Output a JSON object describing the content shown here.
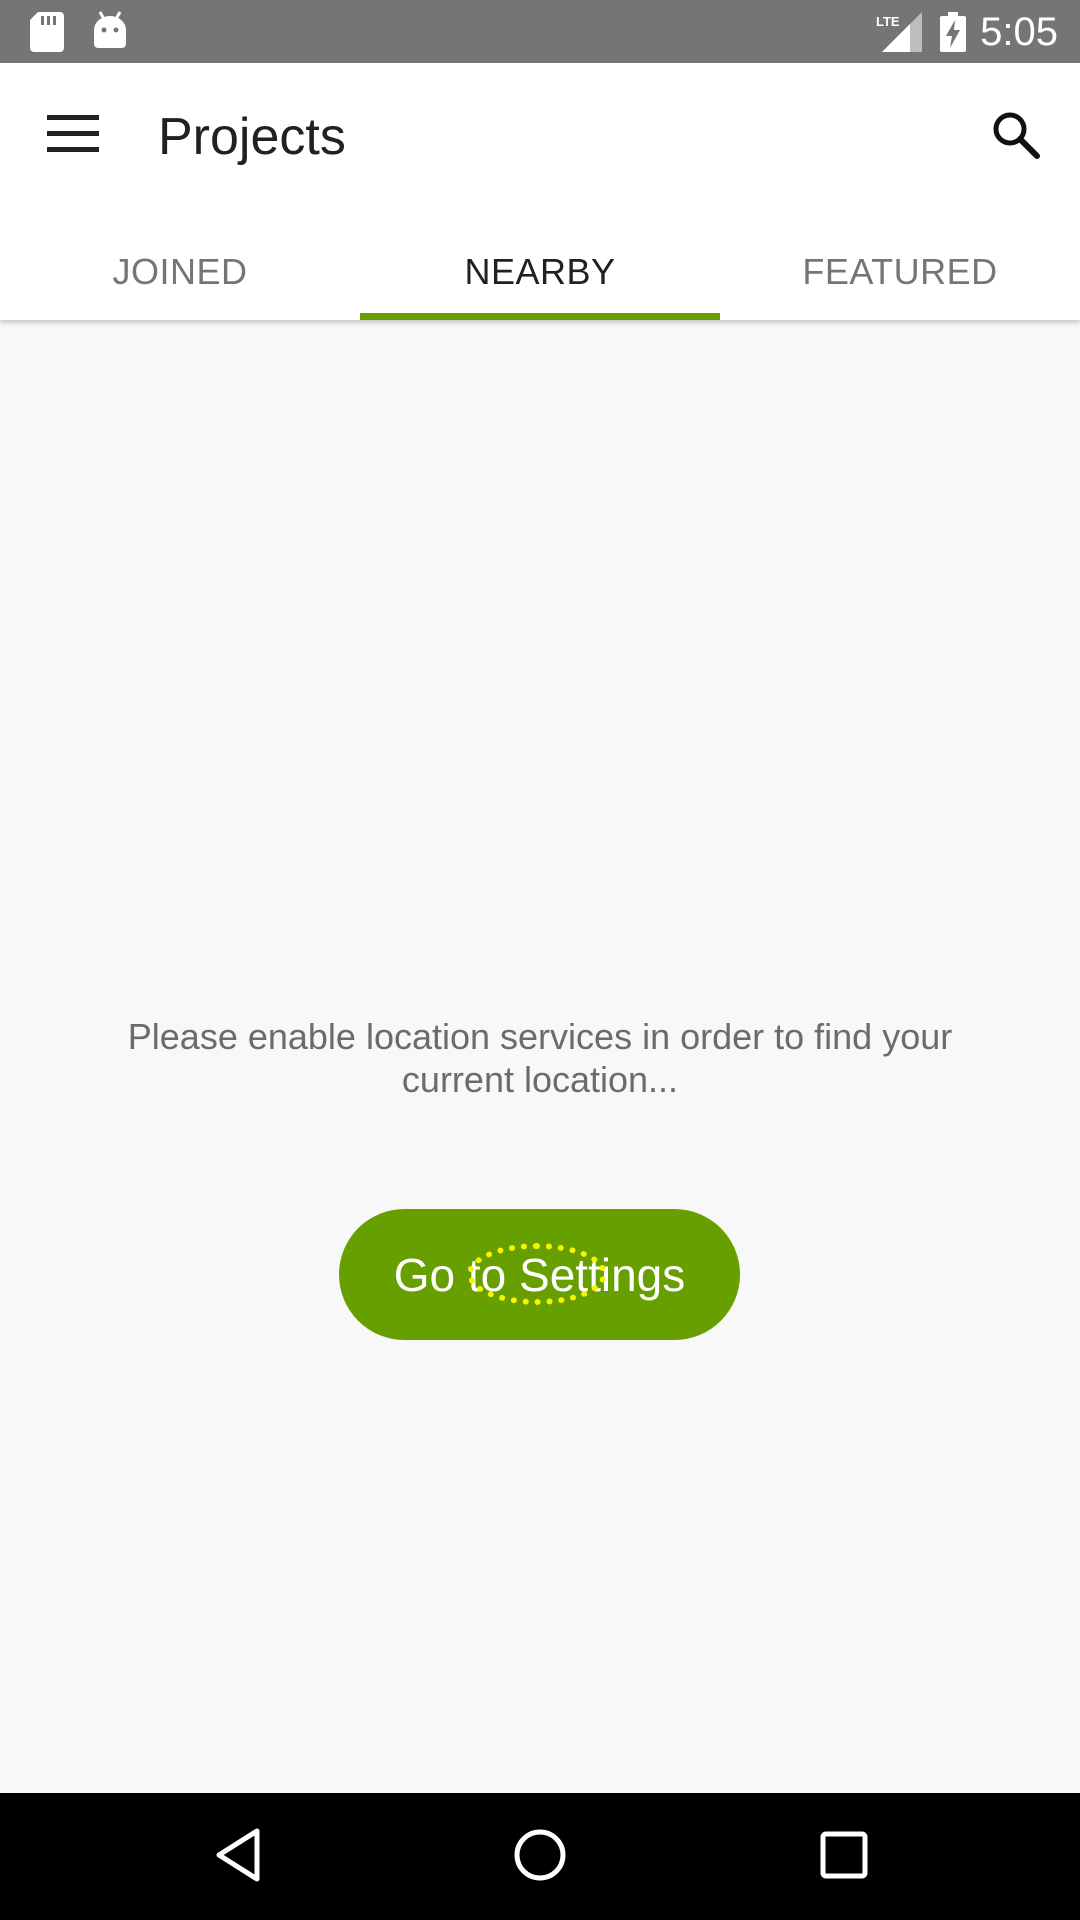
{
  "status_bar": {
    "time": "5:05",
    "network": "LTE",
    "icons": [
      "sd-card-icon",
      "android-icon",
      "lte-signal-icon",
      "battery-charging-icon"
    ]
  },
  "app_bar": {
    "title": "Projects",
    "menu_icon": "hamburger-menu-icon",
    "search_icon": "search-icon"
  },
  "tabs": [
    {
      "label": "JOINED",
      "active": false
    },
    {
      "label": "NEARBY",
      "active": true
    },
    {
      "label": "FEATURED",
      "active": false
    }
  ],
  "content": {
    "message": "Please enable location services in order to find your current location...",
    "button_label": "Go to Settings"
  },
  "nav_bar": {
    "icons": [
      "back-icon",
      "home-icon",
      "recents-icon"
    ]
  },
  "colors": {
    "accent": "#689f00",
    "status_bar": "#757575",
    "background": "#f8f8f8",
    "tap_indicator": "#f5f500"
  }
}
